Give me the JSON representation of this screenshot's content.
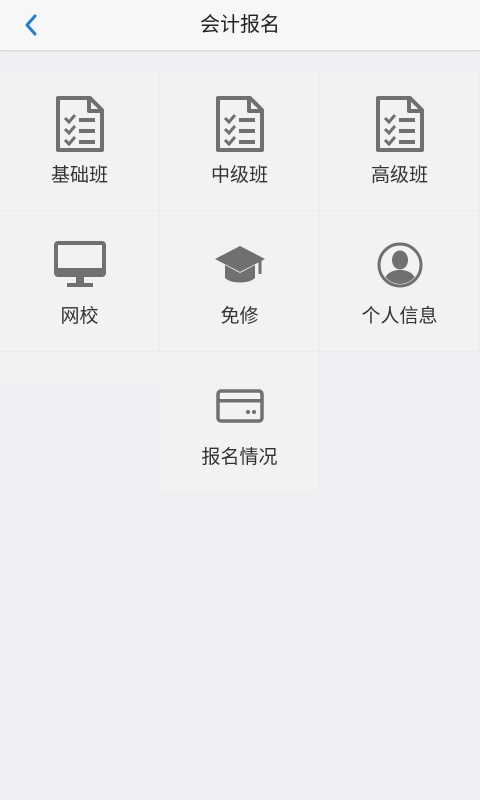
{
  "header": {
    "title": "会计报名",
    "back_icon": "chevron-left-icon",
    "accent_color": "#1a7fd8"
  },
  "menu": {
    "items": [
      {
        "label": "基础班",
        "icon": "document-checklist-icon"
      },
      {
        "label": "中级班",
        "icon": "document-checklist-icon"
      },
      {
        "label": "高级班",
        "icon": "document-checklist-icon"
      },
      {
        "label": "网校",
        "icon": "monitor-icon"
      },
      {
        "label": "免修",
        "icon": "graduation-cap-icon"
      },
      {
        "label": "个人信息",
        "icon": "user-avatar-icon"
      },
      {
        "label": "报名情况",
        "icon": "credit-card-icon"
      }
    ]
  },
  "colors": {
    "icon_gray": "#707070",
    "tile_bg": "#f2f2f2",
    "page_bg": "#eef0f3"
  }
}
